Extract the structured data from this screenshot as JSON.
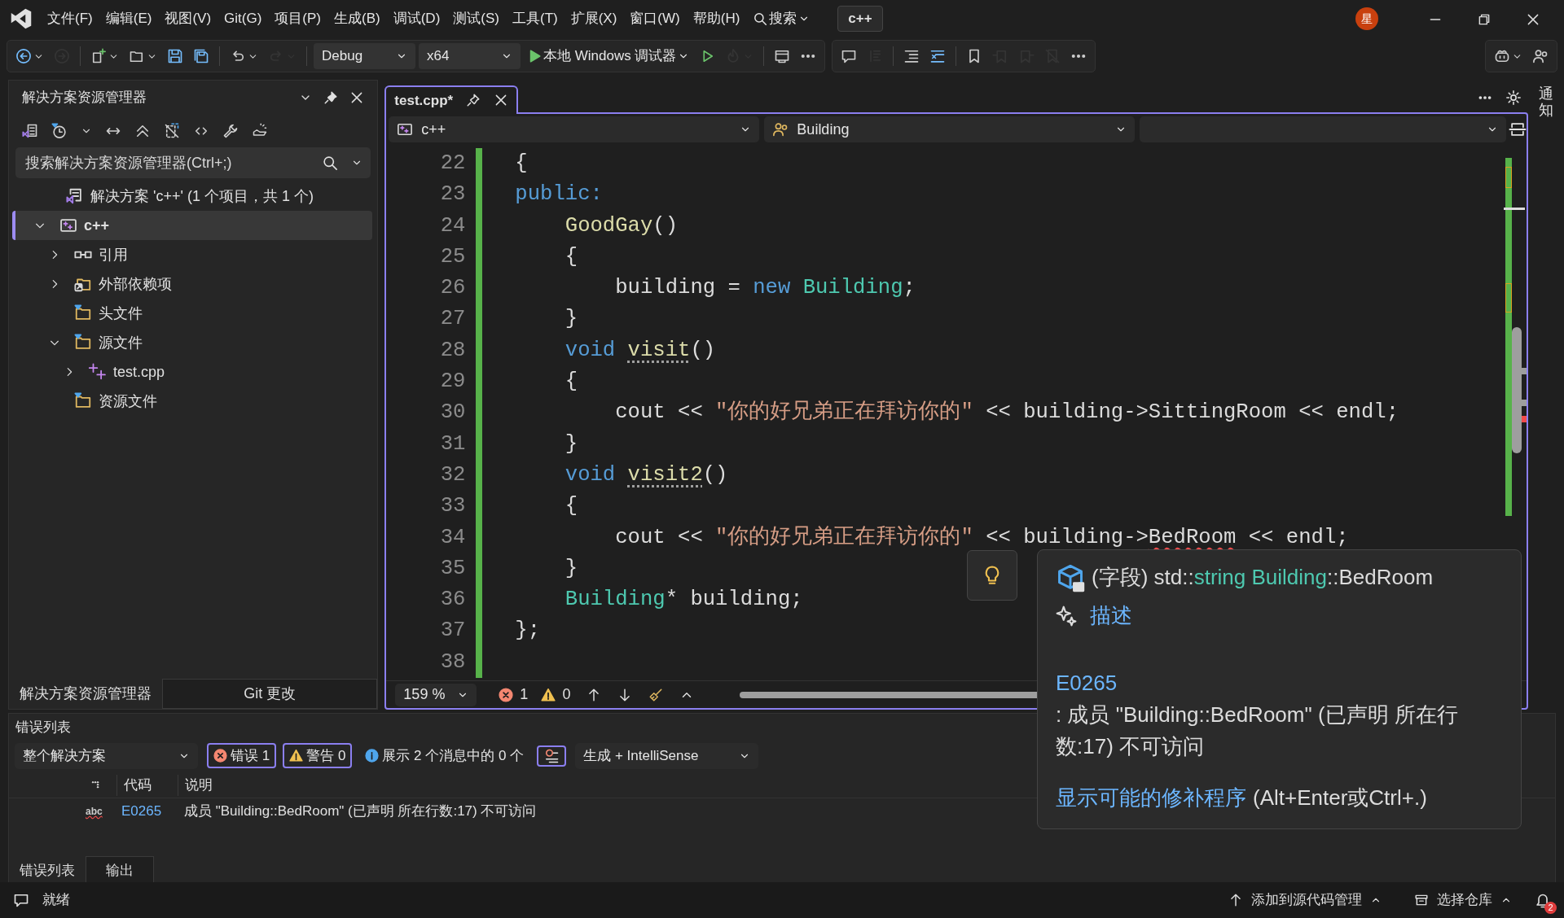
{
  "menubar": {
    "items": [
      "文件(F)",
      "编辑(E)",
      "视图(V)",
      "Git(G)",
      "项目(P)",
      "生成(B)",
      "调试(D)",
      "测试(S)",
      "工具(T)",
      "扩展(X)",
      "窗口(W)",
      "帮助(H)"
    ],
    "search": "搜索",
    "solution": "c++",
    "avatar": "星"
  },
  "toolbar": {
    "groups": [
      [
        {
          "kind": "back",
          "disabled": false,
          "menu": true
        },
        {
          "kind": "forward",
          "disabled": true,
          "menu": false
        },
        {
          "kind": "separator"
        },
        {
          "kind": "new",
          "disabled": false,
          "menu": true
        },
        {
          "kind": "open",
          "disabled": false,
          "menu": true
        },
        {
          "kind": "save",
          "disabled": false,
          "menu": false
        },
        {
          "kind": "saveall",
          "disabled": false,
          "menu": false
        },
        {
          "kind": "separator"
        },
        {
          "kind": "undo",
          "disabled": false,
          "menu": true
        },
        {
          "kind": "redo",
          "disabled": true,
          "menu": true
        },
        {
          "kind": "separator"
        },
        {
          "kind": "dropdown",
          "text": "Debug"
        },
        {
          "kind": "dropdown",
          "text": "x64"
        },
        {
          "kind": "run",
          "text": "本地 Windows 调试器"
        },
        {
          "kind": "start",
          "disabled": false,
          "menu": false
        },
        {
          "kind": "hotreload",
          "disabled": true,
          "menu": true
        },
        {
          "kind": "separator"
        },
        {
          "kind": "window",
          "disabled": false,
          "menu": false
        },
        {
          "kind": "more",
          "disabled": false,
          "menu": false
        }
      ],
      [
        {
          "kind": "quickinfo",
          "disabled": false,
          "menu": false
        },
        {
          "kind": "params",
          "disabled": true,
          "menu": false
        },
        {
          "kind": "separator"
        },
        {
          "kind": "comment",
          "disabled": false,
          "menu": false
        },
        {
          "kind": "uncomment",
          "disabled": false,
          "menu": false
        },
        {
          "kind": "separator"
        },
        {
          "kind": "bookmark",
          "disabled": false,
          "menu": false
        },
        {
          "kind": "bookmarkprev",
          "disabled": true,
          "menu": false
        },
        {
          "kind": "bookmarknext",
          "disabled": true,
          "menu": false
        },
        {
          "kind": "bookmarkclear",
          "disabled": true,
          "menu": false
        },
        {
          "kind": "more",
          "disabled": false,
          "menu": false
        }
      ],
      [
        {
          "kind": "copilot",
          "disabled": false,
          "menu": true
        },
        {
          "kind": "share",
          "disabled": false,
          "menu": false
        }
      ]
    ]
  },
  "explorer": {
    "title": "解决方案资源管理器",
    "search": {
      "placeholder": "搜索解决方案资源管理器(Ctrl+;)"
    },
    "tree": [
      {
        "label": "解决方案 'c++' (1 个项目，共 1 个)",
        "kind": "solution",
        "selected": false,
        "children": [
          {
            "label": "c++",
            "kind": "project",
            "selected": true,
            "expanded": true,
            "children": [
              {
                "label": "引用",
                "kind": "references",
                "selected": false,
                "expanded": false
              },
              {
                "label": "外部依赖项",
                "kind": "external",
                "selected": false,
                "expanded": false
              },
              {
                "label": "头文件",
                "kind": "folder",
                "selected": false
              },
              {
                "label": "源文件",
                "kind": "folder",
                "selected": false,
                "expanded": true,
                "children": [
                  {
                    "label": "test.cpp",
                    "kind": "cpp",
                    "selected": false,
                    "expanded": false
                  }
                ]
              },
              {
                "label": "资源文件",
                "kind": "folder",
                "selected": false
              }
            ]
          }
        ]
      }
    ],
    "tabs": [
      {
        "label": "解决方案资源管理器",
        "selected": true
      },
      {
        "label": "Git 更改",
        "selected": false
      }
    ]
  },
  "editor": {
    "tabs": [
      {
        "label": "test.cpp*",
        "selected": true
      }
    ],
    "nav": [
      {
        "kind": "project",
        "text": "c++"
      },
      {
        "kind": "class",
        "text": "Building"
      },
      {
        "kind": "member"
      }
    ],
    "lines": [
      {
        "number": "22",
        "changed": true,
        "tokens": [
          {
            "text": "{",
            "kind": "plain"
          }
        ]
      },
      {
        "number": "23",
        "changed": true,
        "tokens": [
          {
            "text": "public:",
            "kind": "keyword"
          }
        ]
      },
      {
        "number": "24",
        "changed": true,
        "tokens": [
          {
            "text": "    GoodGay",
            "kind": "func"
          },
          {
            "text": "()",
            "kind": "plain"
          }
        ]
      },
      {
        "number": "25",
        "changed": true,
        "tokens": [
          {
            "text": "    {",
            "kind": "plain"
          }
        ]
      },
      {
        "number": "26",
        "changed": true,
        "tokens": [
          {
            "text": "        building = ",
            "kind": "plain"
          },
          {
            "text": "new ",
            "kind": "keyword"
          },
          {
            "text": "Building",
            "kind": "type"
          },
          {
            "text": ";",
            "kind": "plain"
          }
        ]
      },
      {
        "number": "27",
        "changed": true,
        "tokens": [
          {
            "text": "    }",
            "kind": "plain"
          }
        ]
      },
      {
        "number": "28",
        "changed": true,
        "tokens": [
          {
            "text": "    void ",
            "kind": "keyword"
          },
          {
            "text": "visit",
            "kind": "func",
            "suggestion": true
          },
          {
            "text": "()",
            "kind": "plain"
          }
        ]
      },
      {
        "number": "29",
        "changed": true,
        "tokens": [
          {
            "text": "    {",
            "kind": "plain"
          }
        ]
      },
      {
        "number": "30",
        "changed": true,
        "tokens": [
          {
            "text": "        cout << ",
            "kind": "plain"
          },
          {
            "text": "\"你的好兄弟正在拜访你的\"",
            "kind": "string"
          },
          {
            "text": " << building->SittingRoom << endl;",
            "kind": "plain"
          }
        ]
      },
      {
        "number": "31",
        "changed": true,
        "tokens": [
          {
            "text": "    }",
            "kind": "plain"
          }
        ]
      },
      {
        "number": "32",
        "changed": true,
        "tokens": [
          {
            "text": "    void ",
            "kind": "keyword"
          },
          {
            "text": "visit2",
            "kind": "func",
            "suggestion": true
          },
          {
            "text": "()",
            "kind": "plain"
          }
        ]
      },
      {
        "number": "33",
        "changed": true,
        "tokens": [
          {
            "text": "    {",
            "kind": "plain"
          }
        ]
      },
      {
        "number": "34",
        "changed": true,
        "tokens": [
          {
            "text": "        cout << ",
            "kind": "plain"
          },
          {
            "text": "\"你的好兄弟正在拜访你的\"",
            "kind": "string"
          },
          {
            "text": " << building->",
            "kind": "plain"
          },
          {
            "text": "BedRoom",
            "kind": "plain",
            "error": true
          },
          {
            "text": " << endl;",
            "kind": "plain"
          }
        ]
      },
      {
        "number": "35",
        "changed": true,
        "tokens": [
          {
            "text": "    }",
            "kind": "plain"
          }
        ]
      },
      {
        "number": "36",
        "changed": true,
        "tokens": [
          {
            "text": "    Building",
            "kind": "type"
          },
          {
            "text": "* building;",
            "kind": "plain"
          }
        ]
      },
      {
        "number": "37",
        "changed": true,
        "tokens": [
          {
            "text": "};",
            "kind": "plain"
          }
        ]
      },
      {
        "number": "38",
        "changed": true
      }
    ],
    "zoom": "159 %",
    "errors": "1",
    "warnings": "0"
  },
  "quickinfo": {
    "signature": [
      {
        "text": "(字段) std::",
        "kind": "plain"
      },
      {
        "text": "string Building",
        "kind": "type"
      },
      {
        "text": "::BedRoom",
        "kind": "plain"
      }
    ],
    "describe": "描述",
    "code": "E0265",
    "message": ": 成员 \"Building::BedRoom\" (已声明 所在行数:17) 不可访问",
    "fix": "显示可能的修补程序",
    "shortcut": "(Alt+Enter或Ctrl+.)"
  },
  "error_list": {
    "title": "错误列表",
    "scope": "整个解决方案",
    "filters": [
      {
        "kind": "error",
        "text": "错误 1",
        "selected": true
      },
      {
        "kind": "warning",
        "text": "警告 0",
        "selected": true
      },
      {
        "kind": "info",
        "text": "展示 2 个消息中的 0 个",
        "selected": false
      }
    ],
    "filter_active": true,
    "source": "生成 + IntelliSense",
    "columns": [
      "代码",
      "说明"
    ],
    "rows": [
      {
        "source_mark": "abc",
        "code": "E0265",
        "description": "成员 \"Building::BedRoom\" (已声明 所在行数:17) 不可访问"
      }
    ],
    "tabs": [
      {
        "label": "错误列表",
        "selected": true
      },
      {
        "label": "输出",
        "selected": false
      }
    ]
  },
  "side_tab": "通知",
  "status_bar": {
    "text": "就绪",
    "source_control": "添加到源代码管理",
    "repository": "选择仓库",
    "notifications": "2"
  }
}
